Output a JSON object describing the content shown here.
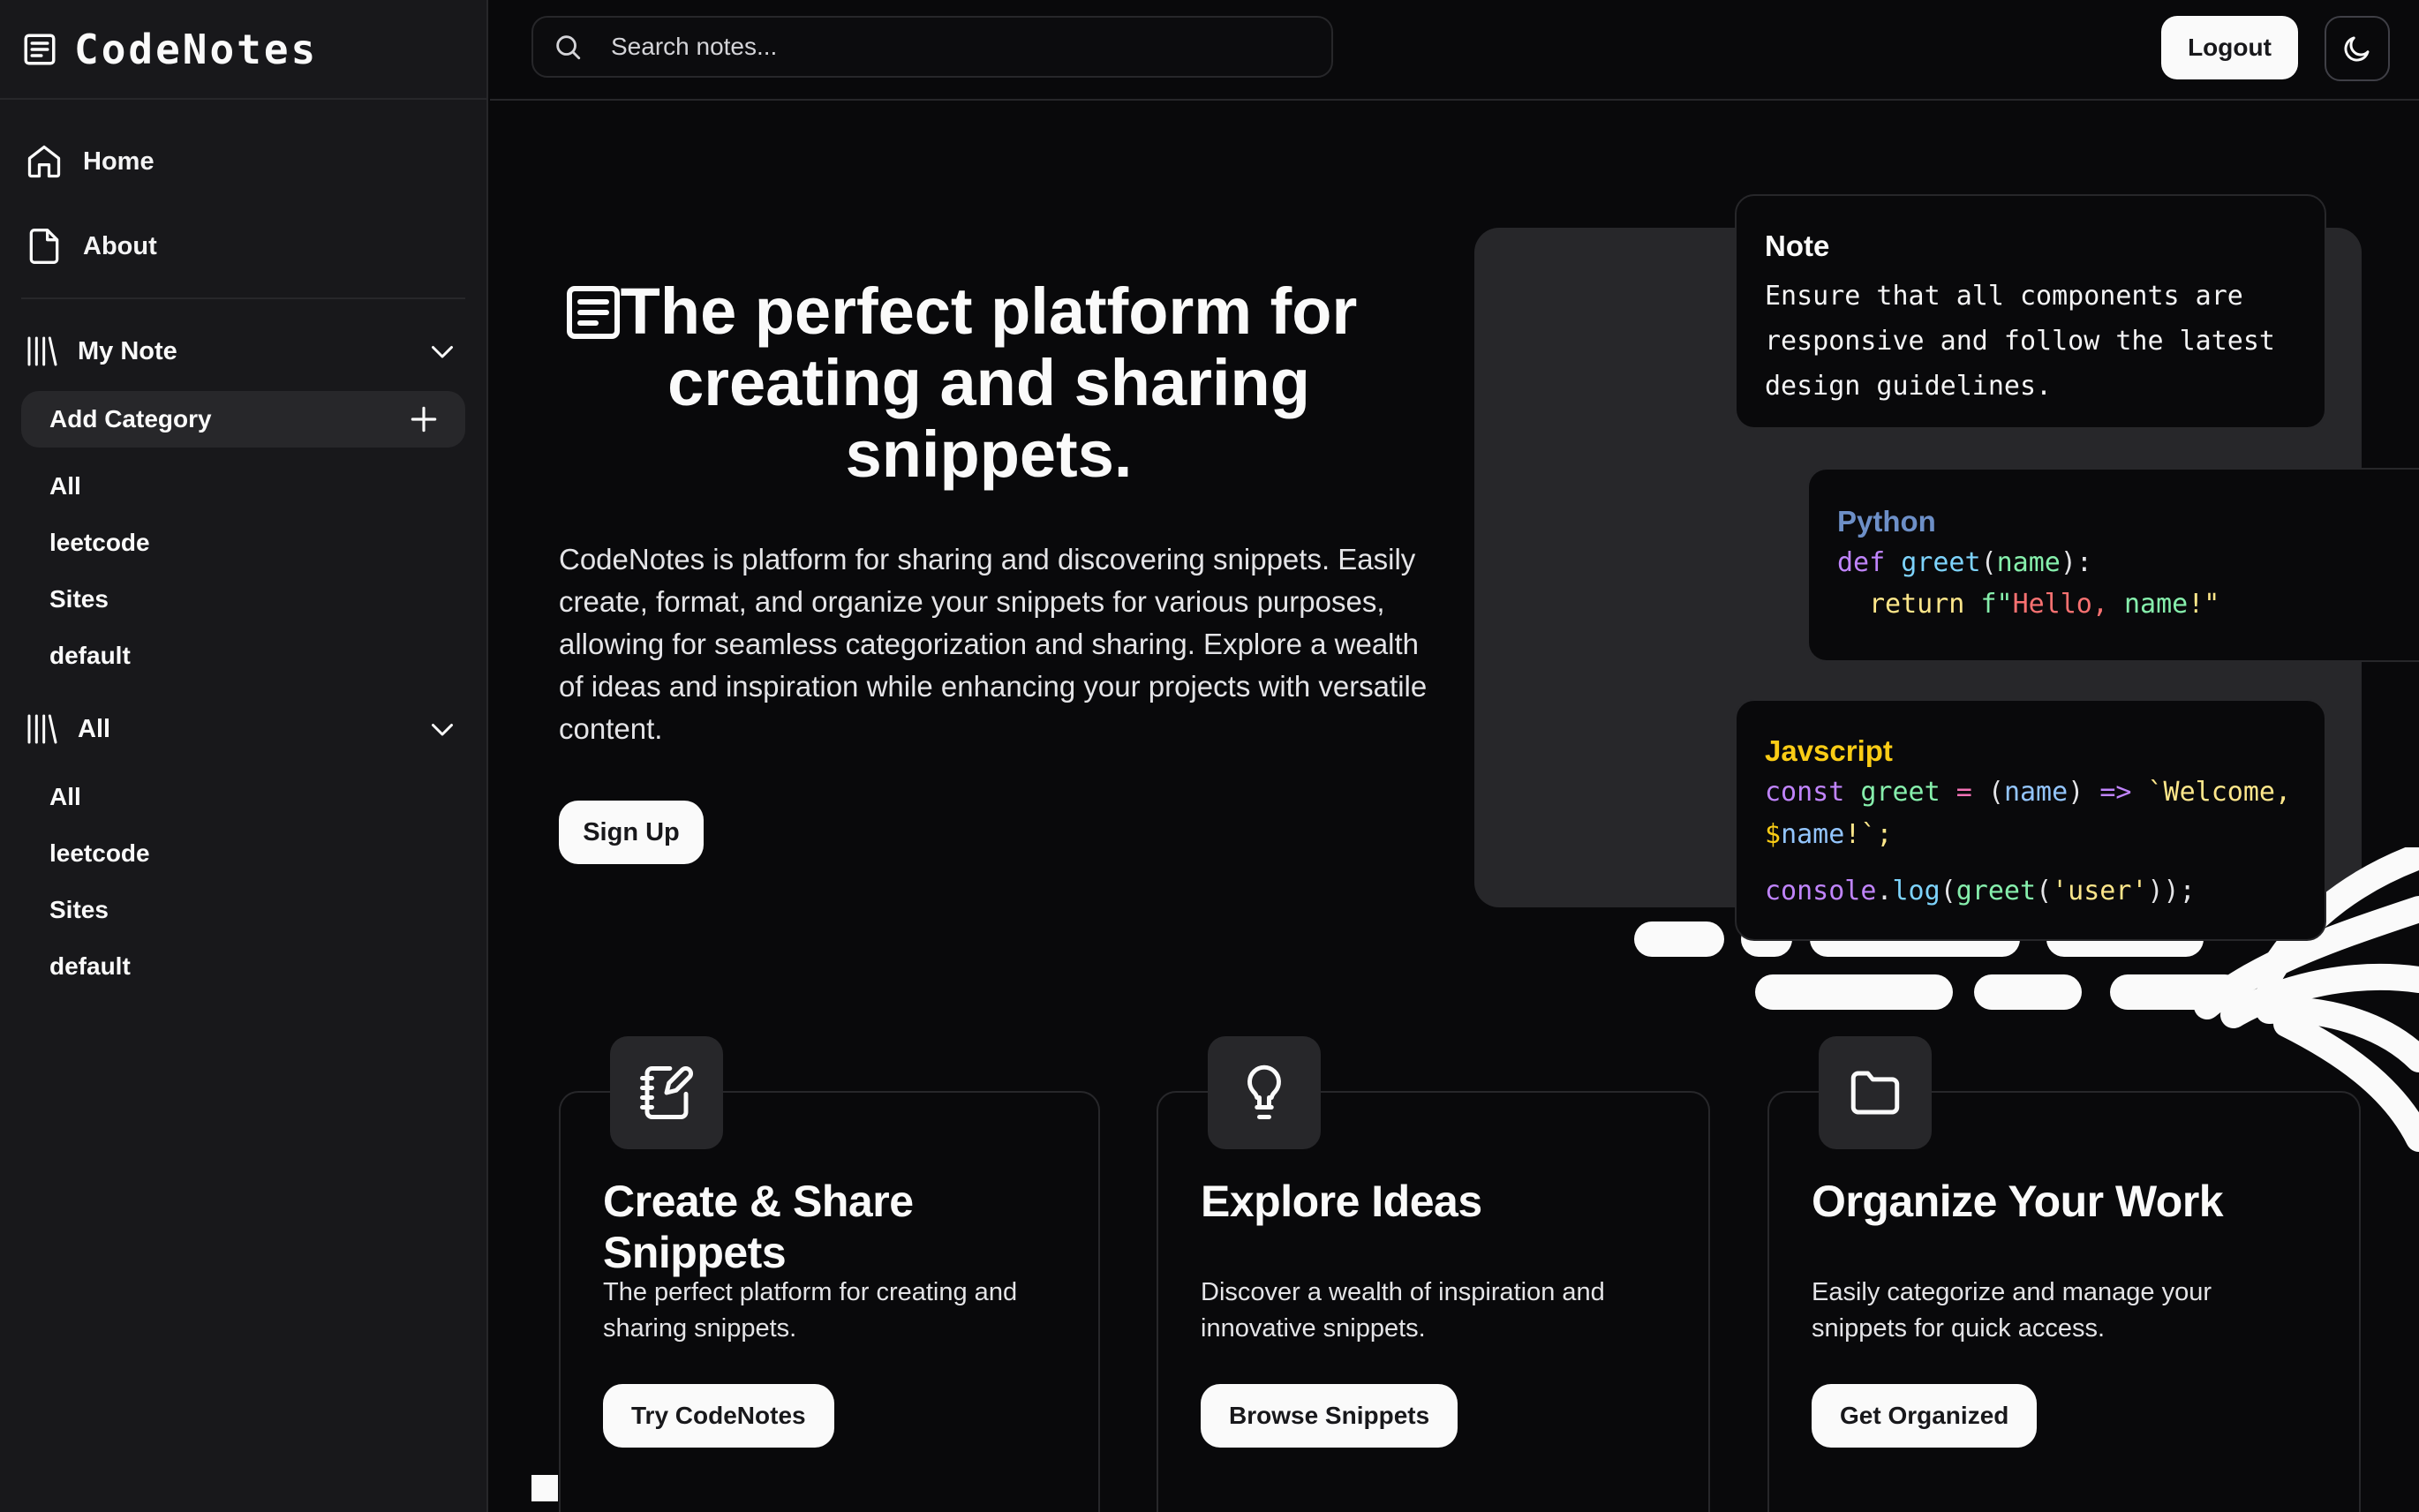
{
  "brand": {
    "name": "CodeNotes"
  },
  "search": {
    "placeholder": "Search notes..."
  },
  "topbar": {
    "logout_label": "Logout"
  },
  "sidebar": {
    "nav": [
      {
        "label": "Home",
        "icon": "home-icon"
      },
      {
        "label": "About",
        "icon": "file-icon"
      }
    ],
    "my_note": {
      "label": "My Note",
      "add_category": "Add Category",
      "items": [
        "All",
        "leetcode",
        "Sites",
        "default"
      ]
    },
    "all": {
      "label": "All",
      "items": [
        "All",
        "leetcode",
        "Sites",
        "default"
      ]
    }
  },
  "hero": {
    "title": "The perfect platform for creating and sharing snippets.",
    "description": "CodeNotes is platform for sharing and discovering snippets. Easily create, format, and organize your snippets for various purposes, allowing for seamless categorization and sharing. Explore a wealth of ideas and inspiration while enhancing your projects with versatile content.",
    "signup_label": "Sign Up"
  },
  "cards": {
    "note": {
      "title": "Note",
      "lines": [
        "Ensure that all components are",
        "responsive and follow the latest",
        "design guidelines."
      ]
    },
    "python": {
      "title": "Python",
      "line1": {
        "kw": "def",
        "fn": "greet",
        "open": "(",
        "arg": "name",
        "close": "):"
      },
      "line2": {
        "kw": "return",
        "prefix": "f\"",
        "str": "Hello, ",
        "var": "name",
        "suffix": "!\""
      }
    },
    "javascript": {
      "title": "Javscript",
      "line1": {
        "kw": "const",
        "fn": "greet",
        "eq": "=",
        "open": "(",
        "arg": "name",
        "close": ")",
        "arrow": "=>",
        "tpl": "`Welcome,",
        "dollar": "$",
        "var": "name",
        "end": "!`;"
      },
      "line2": {
        "obj": "console",
        "dot": ".",
        "method": "log",
        "open": "(",
        "fn": "greet",
        "open2": "(",
        "str": "'user'",
        "close": "));"
      }
    }
  },
  "features": [
    {
      "icon": "notebook-pen-icon",
      "title": "Create & Share Snippets",
      "description": "The perfect platform for creating and sharing snippets.",
      "button": "Try CodeNotes"
    },
    {
      "icon": "lightbulb-icon",
      "title": "Explore Ideas",
      "description": "Discover a wealth of inspiration and innovative snippets.",
      "button": "Browse Snippets"
    },
    {
      "icon": "folder-icon",
      "title": "Organize Your Work",
      "description": "Easily categorize and manage your snippets for quick access.",
      "button": "Get Organized"
    }
  ],
  "colors": {
    "background": "#09090b",
    "sidebar": "#18181b",
    "python_accent": "#6d8fc7",
    "javascript_accent": "#facc15"
  }
}
